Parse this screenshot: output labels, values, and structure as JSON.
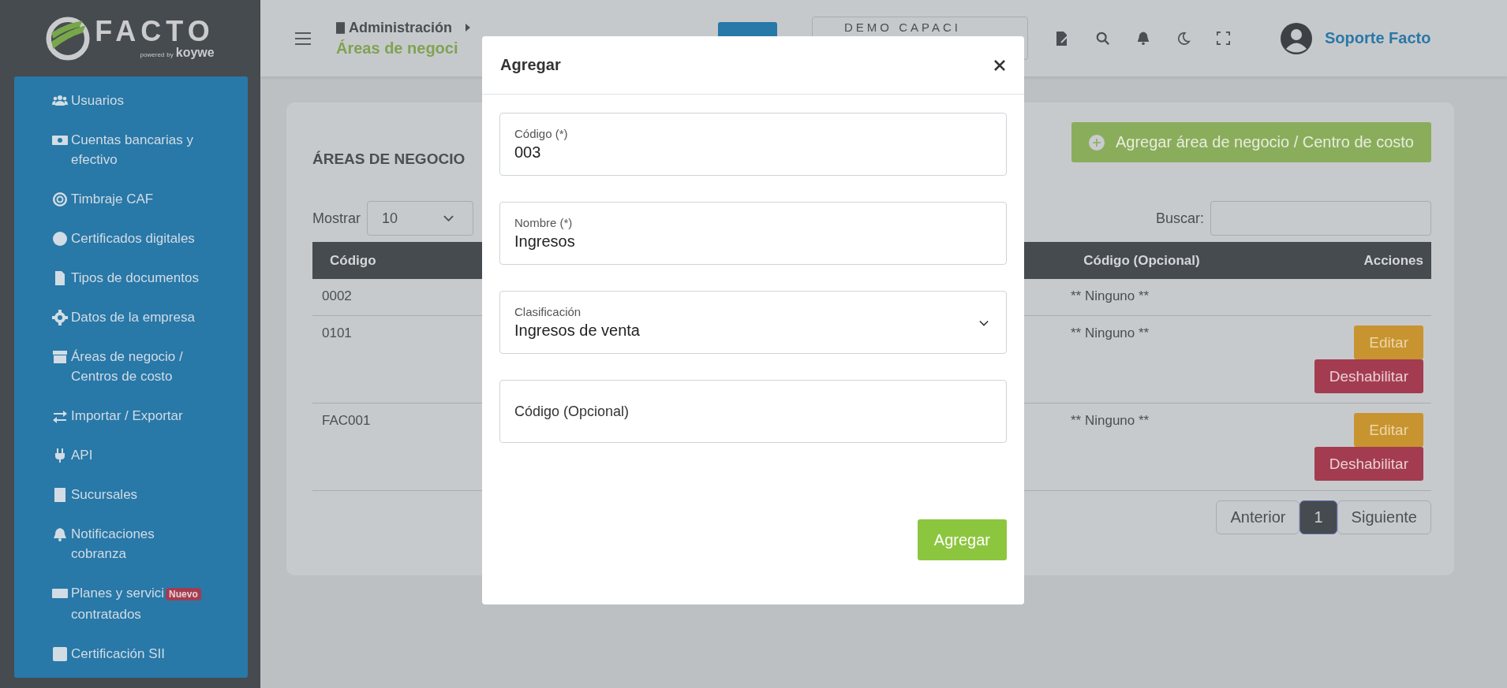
{
  "sidebar": {
    "logo": {
      "name": "FACTO",
      "tagline_1": "powered",
      "tagline_2": "by",
      "tagline_3": "koywe"
    },
    "items": [
      {
        "label": "Usuarios"
      },
      {
        "label": "Cuentas bancarias y efectivo"
      },
      {
        "label": "Timbraje CAF"
      },
      {
        "label": "Certificados digitales"
      },
      {
        "label": "Tipos de documentos"
      },
      {
        "label": "Datos de la empresa"
      },
      {
        "label": "Áreas de negocio / Centros de costo"
      },
      {
        "label": "Importar / Exportar"
      },
      {
        "label": "API"
      },
      {
        "label": "Sucursales"
      },
      {
        "label": "Notificaciones cobranza"
      },
      {
        "label": "Planes y servici",
        "badge": "Nuevo",
        "label_continued": "contratados"
      },
      {
        "label": "Certificación SII"
      }
    ]
  },
  "header": {
    "breadcrumb": {
      "section": "Administración",
      "page": "Áreas de negoci"
    },
    "company_select": {
      "value": "DEMO CAPACI"
    },
    "user": {
      "name": "Soporte Facto"
    }
  },
  "card": {
    "title": "ÁREAS DE NEGOCIO",
    "add_button": "Agregar área de negocio / Centro de costo",
    "show_label": "Mostrar",
    "page_size": "10",
    "search_label": "Buscar:",
    "table": {
      "columns": [
        "Código",
        "Código (Opcional)",
        "Acciones"
      ],
      "rows": [
        {
          "code": "0002",
          "optional": "** Ninguno **",
          "actions": []
        },
        {
          "code": "0101",
          "optional": "** Ninguno **",
          "actions": [
            {
              "label": "Editar",
              "kind": "edit"
            },
            {
              "label": "Deshabilitar",
              "kind": "disable"
            }
          ]
        },
        {
          "code": "FAC001",
          "optional": "** Ninguno **",
          "actions": [
            {
              "label": "Editar",
              "kind": "edit"
            },
            {
              "label": "Deshabilitar",
              "kind": "disable"
            }
          ]
        }
      ]
    },
    "pagination": {
      "prev": "Anterior",
      "pages": [
        {
          "label": "1",
          "selected": true
        }
      ],
      "next": "Siguiente"
    }
  },
  "modal": {
    "title": "Agregar",
    "fields": [
      {
        "kind": "text",
        "label": "Código (*)",
        "value": "003"
      },
      {
        "kind": "text",
        "label": "Nombre (*)",
        "value": "Ingresos"
      },
      {
        "kind": "select",
        "label": "Clasificación",
        "value": "Ingresos de venta"
      },
      {
        "kind": "text",
        "placeholder": "Código (Opcional)"
      }
    ],
    "submit": "Agregar"
  }
}
